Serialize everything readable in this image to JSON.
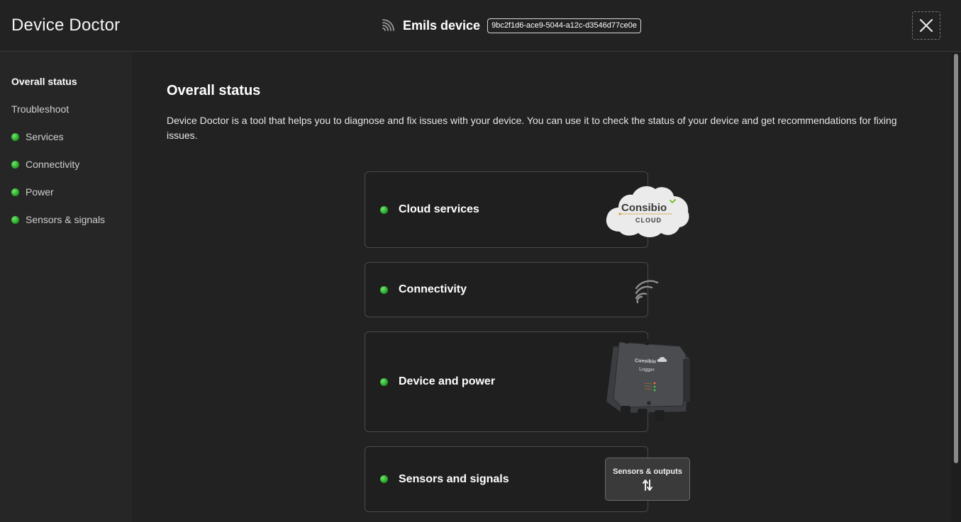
{
  "header": {
    "app_title": "Device Doctor",
    "device_name": "Emils device",
    "device_id": "9bc2f1d6-ace9-5044-a12c-d3546d77ce0e",
    "icons": {
      "connection": "wifi-signal-icon",
      "close": "close-icon"
    }
  },
  "sidebar": {
    "items": [
      {
        "label": "Overall status",
        "status": null,
        "active": true
      },
      {
        "label": "Troubleshoot",
        "status": null,
        "active": false
      },
      {
        "label": "Services",
        "status": "ok",
        "active": false
      },
      {
        "label": "Connectivity",
        "status": "ok",
        "active": false
      },
      {
        "label": "Power",
        "status": "ok",
        "active": false
      },
      {
        "label": "Sensors & signals",
        "status": "ok",
        "active": false
      }
    ]
  },
  "main": {
    "title": "Overall status",
    "intro": "Device Doctor is a tool that helps you to diagnose and fix issues with your device. You can use it to check the status of your device and get recommendations for fixing issues.",
    "cards": [
      {
        "label": "Cloud services",
        "status": "ok",
        "logo_text": "Consibio",
        "logo_sub": "CLOUD"
      },
      {
        "label": "Connectivity",
        "status": "ok"
      },
      {
        "label": "Device and power",
        "status": "ok",
        "device_brand": "Consibio",
        "device_model": "Logger"
      },
      {
        "label": "Sensors and signals",
        "status": "ok",
        "box_label": "Sensors & outputs"
      }
    ]
  },
  "colors": {
    "background": "#222222",
    "sidebar": "#262626",
    "card": "#1f1f1f",
    "status_ok": "#3ec43a",
    "consibio_green": "#7bbf3a"
  }
}
